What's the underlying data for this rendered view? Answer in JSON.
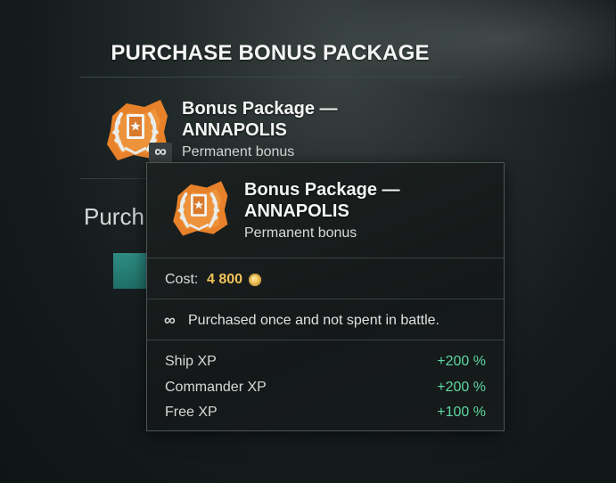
{
  "dialog": {
    "title": "PURCHASE BONUS PACKAGE",
    "background_purchase_text": "Purch",
    "package": {
      "name_line1": "Bonus Package —",
      "name_line2": "ANNAPOLIS",
      "subtitle": "Permanent bonus",
      "icon": "laurel-card-icon",
      "badge_icon": "infinity-icon",
      "badge_text": "∞"
    }
  },
  "tooltip": {
    "name_line1": "Bonus Package —",
    "name_line2": "ANNAPOLIS",
    "subtitle": "Permanent bonus",
    "cost_label": "Cost:",
    "cost_value": "4 800",
    "cost_icon": "credits-coin-icon",
    "note_icon": "∞",
    "note_text": "Purchased once and not spent in battle.",
    "stats": [
      {
        "label": "Ship XP",
        "value": "+200 %"
      },
      {
        "label": "Commander XP",
        "value": "+200 %"
      },
      {
        "label": "Free XP",
        "value": "+100 %"
      }
    ]
  },
  "colors": {
    "accent_orange": "#e8822a",
    "cost_gold": "#f1c45a",
    "bonus_green": "#5dd8a2",
    "button_teal": "#2f8d83"
  }
}
